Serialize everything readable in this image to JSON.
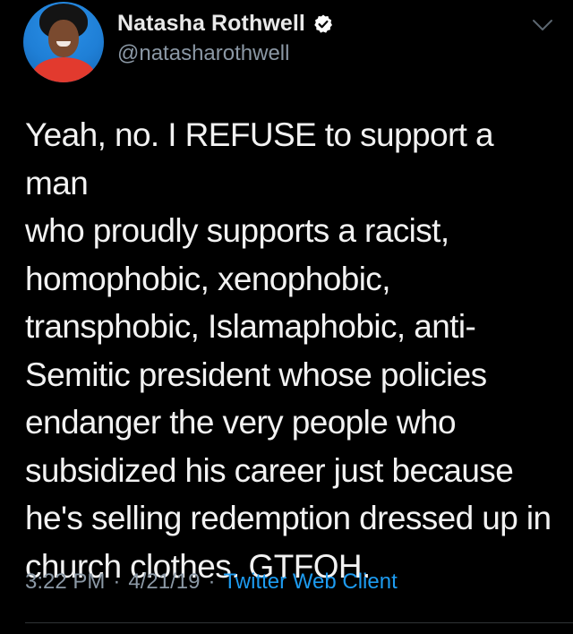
{
  "tweet": {
    "author": {
      "display_name": "Natasha Rothwell",
      "handle": "@natasharothwell",
      "verified": true
    },
    "text": "Yeah, no. I REFUSE to support a man\nwho proudly supports a racist,\nhomophobic, xenophobic,\ntransphobic, Islamaphobic, anti-\nSemitic president whose policies\nendanger the very people who\nsubsidized his career just because\nhe's selling redemption dressed up in\nchurch clothes. GTFOH.",
    "time": "3:22 PM",
    "separator": "·",
    "date": "4/21/19",
    "client": "Twitter Web Client"
  },
  "icons": {
    "verified": "verified-badge-icon",
    "menu": "chevron-down-icon"
  },
  "colors": {
    "background": "#000000",
    "secondary_text": "#8b98a5",
    "link": "#1d9bf0"
  }
}
